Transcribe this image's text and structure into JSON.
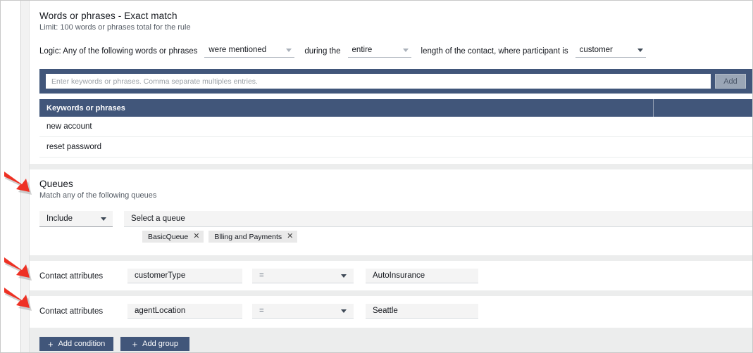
{
  "words_section": {
    "title": "Words or phrases - Exact match",
    "subtitle": "Limit: 100 words or phrases total for the rule",
    "logic": {
      "prefix_label": "Logic: Any of the following words or phrases",
      "mentioned_value": "were mentioned",
      "during_label": "during the",
      "duration_value": "entire",
      "length_label": "length of the contact, where participant is",
      "participant_value": "customer"
    },
    "keyword_input_placeholder": "Enter keywords or phrases. Comma separate multiples entries.",
    "keyword_input_value": "",
    "add_button_label": "Add",
    "table": {
      "column_header": "Keywords or phrases",
      "rows": [
        "new account",
        "reset password"
      ]
    }
  },
  "queues_section": {
    "title": "Queues",
    "subtitle": "Match any of the following queues",
    "include_value": "Include",
    "queue_placeholder": "Select a queue",
    "chips": [
      {
        "label": "BasicQueue",
        "remove_icon": "close-icon"
      },
      {
        "label": "Blling and Payments",
        "remove_icon": "close-icon"
      }
    ]
  },
  "contact_attributes": [
    {
      "label": "Contact attributes",
      "key": "customerType",
      "operator": "=",
      "value": "AutoInsurance"
    },
    {
      "label": "Contact attributes",
      "key": "agentLocation",
      "operator": "=",
      "value": "Seattle"
    }
  ],
  "footer": {
    "add_condition_label": "Add condition",
    "add_group_label": "Add group",
    "plus_icon": "plus-icon"
  },
  "annotations": {
    "arrow_icon": "arrow-down-right-icon",
    "arrow_color": "#ee3124",
    "count": 3
  },
  "colors": {
    "navy": "#41567a",
    "field_bg": "#f4f4f4",
    "page_bg": "#eceded",
    "text": "#16191f",
    "muted_text": "#545b64"
  }
}
